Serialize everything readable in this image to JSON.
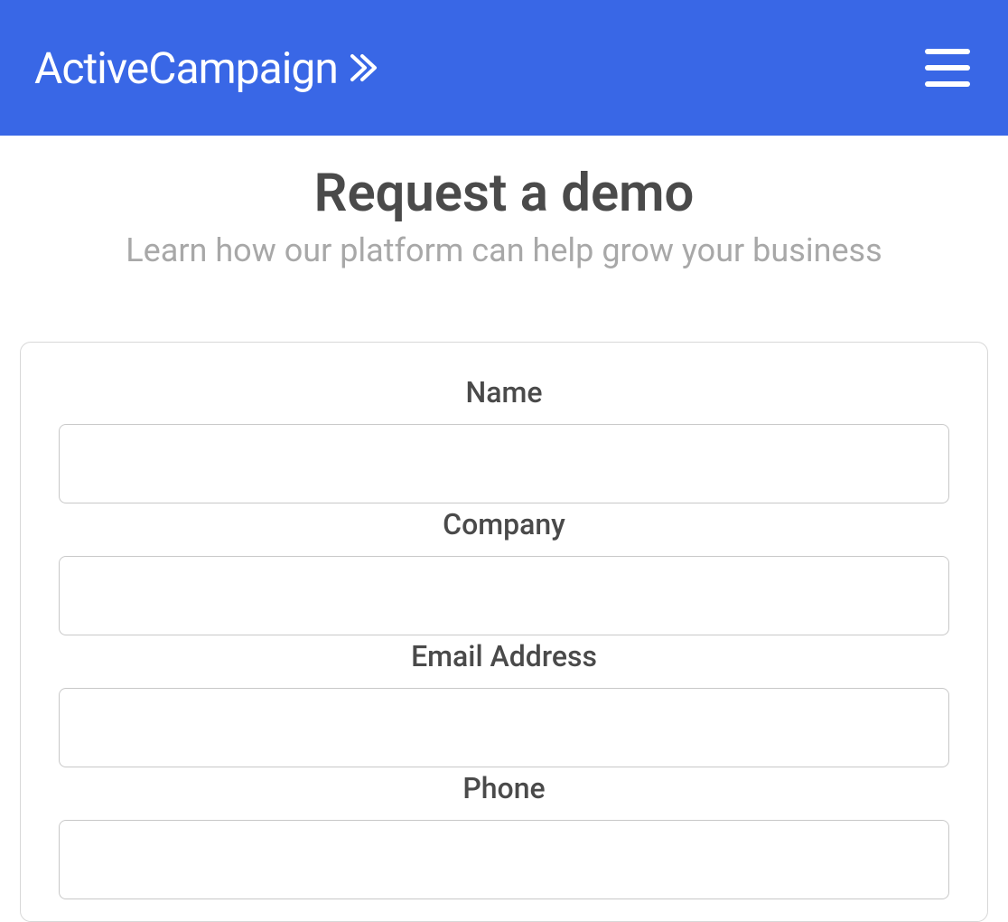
{
  "header": {
    "brand": "ActiveCampaign"
  },
  "main": {
    "title": "Request a demo",
    "subtitle": "Learn how our platform can help grow your business"
  },
  "form": {
    "fields": [
      {
        "label": "Name",
        "value": ""
      },
      {
        "label": "Company",
        "value": ""
      },
      {
        "label": "Email Address",
        "value": ""
      },
      {
        "label": "Phone",
        "value": ""
      }
    ]
  },
  "colors": {
    "primary": "#3967e6",
    "text_dark": "#4a4a4a",
    "text_light": "#a8a8a8",
    "border": "#d8d8d8"
  }
}
